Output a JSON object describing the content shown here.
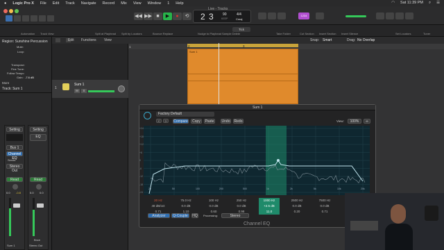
{
  "menubar": {
    "app": "Logic Pro X",
    "items": [
      "File",
      "Edit",
      "Track",
      "Navigate",
      "Record",
      "Mix",
      "View",
      "Window",
      "1",
      "Help"
    ],
    "clock": "Sat 11:39 PM"
  },
  "window_title": "Live - Tracks",
  "lcd": {
    "bar": "2",
    "beat": "3",
    "tempo_value": "90",
    "tempo_label": "KEEP",
    "signature": "4/4",
    "key": "Cmaj"
  },
  "cpu_badge": "1234",
  "toolbar_labels": {
    "automation": "Automation",
    "track_view": "Track View",
    "split_playhead": "Split at Playhead",
    "split_locator": "Split by Locators",
    "bounce_replace": "Bounce Replace",
    "nudge": "Nudge to Playhead",
    "sample_delete": "Sample Delete",
    "take_folder": "Take Folder",
    "cut_section": "Cut Section",
    "insert_section": "Insert Section",
    "insert_silence": "Insert Silence",
    "set_locators": "Set Locators",
    "tuner": "Tuner"
  },
  "menu_row": {
    "edit": "Edit",
    "functions": "Functions",
    "view": "View",
    "snap_label": "Snap:",
    "snap_value": "Smart",
    "drag_label": "Drag:",
    "drag_value": "No Overlap"
  },
  "inspector": {
    "region_label": "Region: Sunshine Percussion",
    "mute": "Mute:",
    "loop": "Loop:",
    "transpose": "Transpose:",
    "fine_tune": "Fine Tune:",
    "follow_tempo": "Follow Tempo",
    "gain_label": "Gain:",
    "gain_value": "-7.6 dB",
    "more": "More",
    "track_label": "Track: Sum 1",
    "ch_settings": "Setting",
    "ch_eq": "EQ",
    "ch_input": "Bus 1",
    "ch_input_name": "Channel EQ",
    "ch_sends": "Sends",
    "ch_output": "Stereo Out",
    "ch_read": "Read",
    "left_val": "0.0",
    "left_peak": "-0.8",
    "right_val": "0.0",
    "right_peak": "0.0",
    "strip_name_left": "Sum 1",
    "strip_name_right": "Stereo Out",
    "bnce": "Bnce"
  },
  "track": {
    "number": "1",
    "name": "Sum 1",
    "m": "M",
    "s": "S"
  },
  "ruler": [
    "1",
    "2",
    "3"
  ],
  "region_name": "Sum 1",
  "eq": {
    "title": "Sum 1",
    "preset": "Factory Default",
    "compare": "Compare",
    "copy": "Copy",
    "paste": "Paste",
    "undo": "Undo",
    "redo": "Redo",
    "view_label": "View:",
    "view_value": "100%",
    "analyzer": "Analyzer",
    "q_couple": "Q-Couple",
    "hq": "HQ",
    "processing_label": "Processing:",
    "processing_value": "Stereo",
    "name": "Channel EQ",
    "db_scale": [
      "+24",
      "+18",
      "+12",
      "+6",
      "0",
      "-6",
      "-12",
      "-18",
      "-24"
    ],
    "freq_scale": [
      "20",
      "50",
      "100",
      "200",
      "500",
      "1k",
      "2k",
      "5k",
      "10k",
      "20k"
    ],
    "bands": [
      {
        "freq": "20 Hz",
        "gain": "48 dB/oct",
        "q": "0.71"
      },
      {
        "freq": "75.0 Hz",
        "gain": "0.0 dB",
        "q": "1.10"
      },
      {
        "freq": "100 Hz",
        "gain": "0.0 dB",
        "q": "0.60"
      },
      {
        "freq": "250 Hz",
        "gain": "0.0 dB",
        "q": "0.98"
      },
      {
        "freq": "1000 Hz",
        "gain": "+2.5 dB",
        "q": "11.0"
      },
      {
        "freq": "2500 Hz",
        "gain": "0.0 dB",
        "q": "0.20"
      },
      {
        "freq": "7500 Hz",
        "gain": "0.0 dB",
        "q": "0.71"
      },
      {
        "freq": "17000 Hz",
        "gain": "12 dB/oct",
        "q": "0.71"
      }
    ],
    "colors": {
      "accent": "#3aa6c8",
      "selected_band": "#1f8a6a",
      "curve": "#bfe3ec",
      "analyzer": "#7f9099"
    }
  },
  "colors": {
    "region": "#e08a2c",
    "play": "#27b34a",
    "record": "#d8342c",
    "cpu": "#b14fd0",
    "volume": "#35c95a"
  }
}
